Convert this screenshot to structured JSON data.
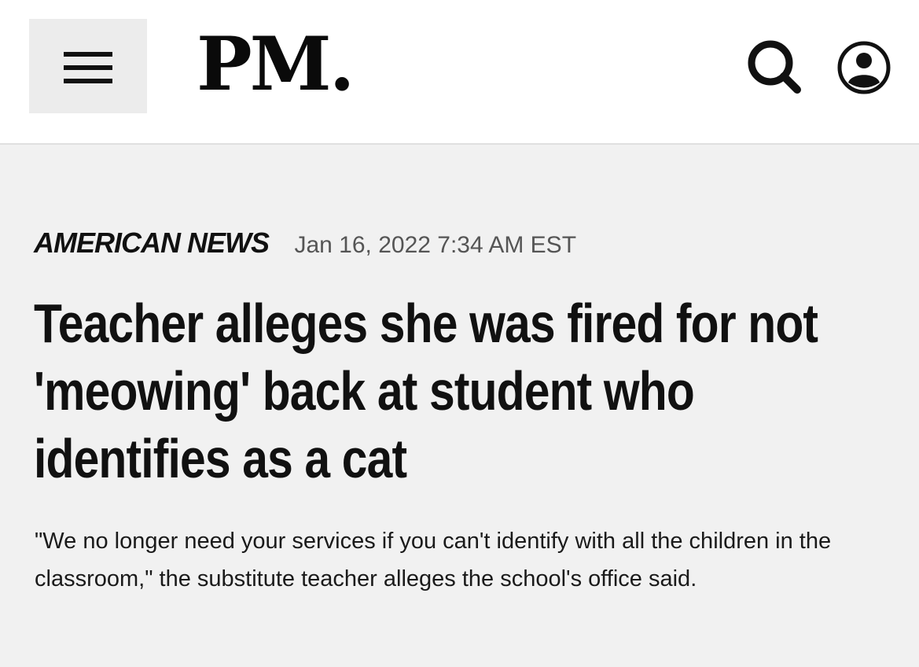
{
  "header": {
    "logo": "PM.",
    "menu_icon": "hamburger-menu-icon",
    "search_icon": "search-icon",
    "account_icon": "user-account-icon"
  },
  "article": {
    "category": "AMERICAN NEWS",
    "date": "Jan 16, 2022 7:34 AM EST",
    "headline": "Teacher alleges she was fired for not 'meowing' back at student who identifies as a cat",
    "subhead": "\"We no longer need your services if you can't identify with all the children in the classroom,\" the substitute teacher alleges the school's office said."
  },
  "colors": {
    "header_bg": "#ffffff",
    "page_bg": "#f1f1f1",
    "text": "#111111",
    "date_text": "#555555"
  }
}
